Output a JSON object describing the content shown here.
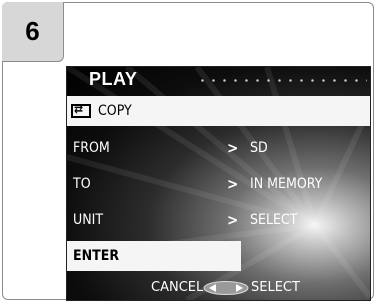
{
  "step": {
    "number": "6"
  },
  "menu": {
    "title": "PLAY",
    "header_item": {
      "label": "COPY",
      "icon": "copy-icon"
    },
    "rows": [
      {
        "label": "FROM",
        "value": "SD"
      },
      {
        "label": "TO",
        "value": "IN MEMORY"
      },
      {
        "label": "UNIT",
        "value": "SELECT"
      }
    ],
    "enter_label": "ENTER"
  },
  "footer": {
    "cancel_label": "CANCEL",
    "select_label": "SELECT"
  }
}
